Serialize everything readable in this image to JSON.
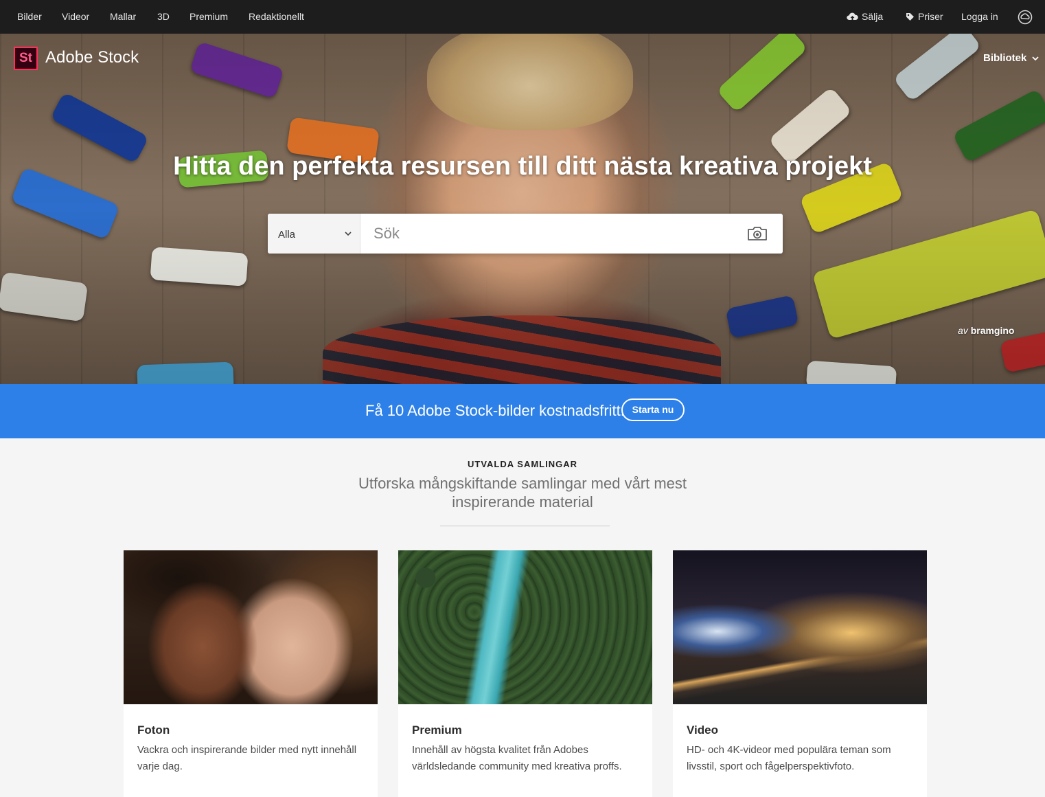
{
  "top_nav": {
    "left_items": [
      "Bilder",
      "Videor",
      "Mallar",
      "3D",
      "Premium",
      "Redaktionellt"
    ],
    "sell_label": "Sälja",
    "pricing_label": "Priser",
    "login_label": "Logga in",
    "creative_cloud_icon": "creative-cloud-icon"
  },
  "header": {
    "logo_mark": "St",
    "logo_text": "Adobe Stock",
    "library_label": "Bibliotek"
  },
  "hero": {
    "title": "Hitta den perfekta resursen till ditt nästa kreativa projekt",
    "search": {
      "category_value": "Alla",
      "placeholder": "Sök"
    },
    "credit_prefix": "av",
    "credit_author": "bramgino"
  },
  "promo": {
    "text": "Få 10 Adobe Stock-bilder kostnadsfritt.",
    "button_label": "Starta nu",
    "background_color": "#2d80e8"
  },
  "collections": {
    "eyebrow": "UTVALDA SAMLINGAR",
    "subtitle": "Utforska mångskiftande samlingar med vårt mest inspirerande material",
    "cards": [
      {
        "title": "Foton",
        "description": "Vackra och inspirerande bilder med nytt innehåll varje dag."
      },
      {
        "title": "Premium",
        "description": "Innehåll av högsta kvalitet från Adobes världsledande community med kreativa proffs."
      },
      {
        "title": "Video",
        "description": "HD- och 4K-videor med populära teman som livsstil, sport och fågelperspektivfoto."
      }
    ]
  }
}
